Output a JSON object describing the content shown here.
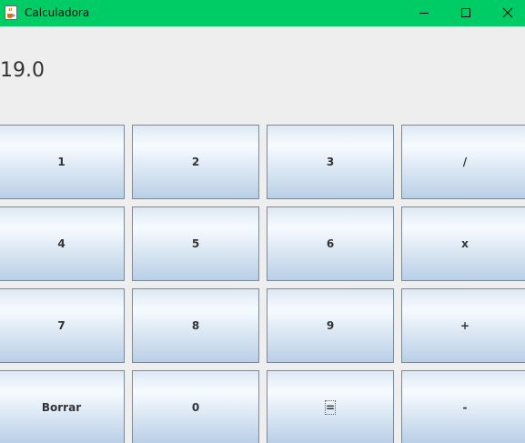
{
  "window": {
    "title": "Calculadora",
    "titlebar_color": "#00cc66",
    "app_icon": "java-cup-icon"
  },
  "display": {
    "value": "19.0"
  },
  "keys": {
    "k1": "1",
    "k2": "2",
    "k3": "3",
    "divide": "/",
    "k4": "4",
    "k5": "5",
    "k6": "6",
    "multiply": "x",
    "k7": "7",
    "k8": "8",
    "k9": "9",
    "plus": "+",
    "clear": "Borrar",
    "k0": "0",
    "equals": "=",
    "minus": "-"
  }
}
